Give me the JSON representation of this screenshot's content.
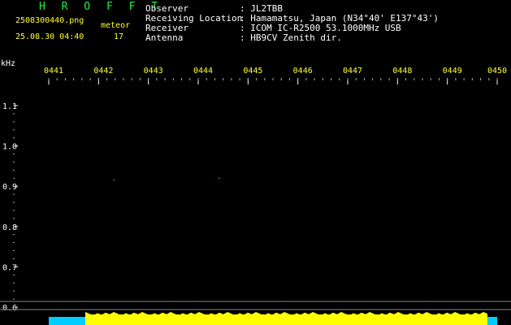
{
  "app": {
    "title": "H R O F F T"
  },
  "capture": {
    "file": "2508300440.png",
    "datetime": "25.08.30 04:40",
    "meteor_label": "meteor",
    "meteor_count": "17"
  },
  "station": {
    "labels": [
      "Observer",
      "Receiving Location",
      "Receiver",
      "Antenna"
    ],
    "values": [
      ": JL2TBB",
      ": Hamamatsu, Japan (N34°40' E137°43')",
      ": ICOM IC-R2500 53.1000MHz USB",
      ": HB9CV Zenith dir."
    ]
  },
  "chart_data": {
    "type": "spectrogram",
    "ylabel": "kHz",
    "yticks": [
      "1.1",
      "1.0",
      "0.9",
      "0.8",
      "0.7",
      "0.6"
    ],
    "ylim": [
      0.6,
      1.1
    ],
    "xticks": [
      "0441",
      "0442",
      "0443",
      "0444",
      "0445",
      "0446",
      "0447",
      "0448",
      "0449",
      "0450"
    ],
    "carrier_khz": 0.93,
    "colors": {
      "background": "#000000",
      "signal_start": "#3399ff",
      "signal_mid": "#ee3322",
      "signal_end": "#22aaff",
      "bottom_noise": "#ffff00",
      "bottom_cyan": "#00ccff"
    }
  }
}
